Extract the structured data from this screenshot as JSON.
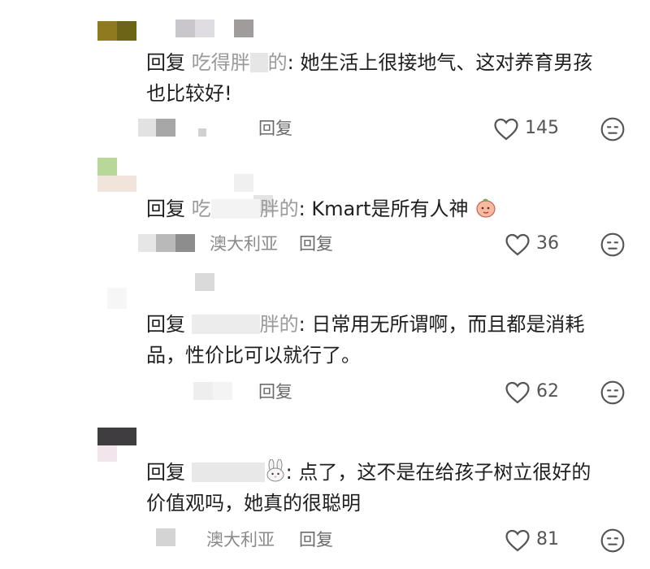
{
  "comments": [
    {
      "reply_keyword": "回复",
      "reply_target": "吃得胖",
      "target_tail": "的",
      "text_line1": ": 她生活上很接地气、这对养育男孩",
      "text_line2": "也比较好!",
      "location": "",
      "reply_label": "回复",
      "like_count": "145"
    },
    {
      "reply_keyword": "回复",
      "reply_target": "吃",
      "target_tail": "胖的",
      "text_line1": ": Kmart是所有人神",
      "text_line2": "",
      "emoji": "peach-face-emoji",
      "location": "澳大利亚",
      "reply_label": "回复",
      "like_count": "36"
    },
    {
      "reply_keyword": "回复",
      "reply_target": "",
      "target_tail": "胖的",
      "text_line1": ": 日常用无所谓啊，而且都是消耗",
      "text_line2": "品，性价比可以就行了。",
      "location": "",
      "reply_label": "回复",
      "like_count": "62"
    },
    {
      "reply_keyword": "回复",
      "reply_target": "",
      "target_tail": "",
      "text_line1": ": 点了，这不是在给孩子树立很好的",
      "text_line2": "价值观吗，她真的很聪明",
      "emoji": "bunny-emoji",
      "location": "澳大利亚",
      "reply_label": "回复",
      "like_count": "81"
    }
  ],
  "icons": {
    "like": "heart-outline-icon",
    "emoji": "smiley-face-icon"
  },
  "colors": {
    "text": "#1f1f1f",
    "muted": "#8a8a8a",
    "reply_button": "#6b6b6b"
  }
}
